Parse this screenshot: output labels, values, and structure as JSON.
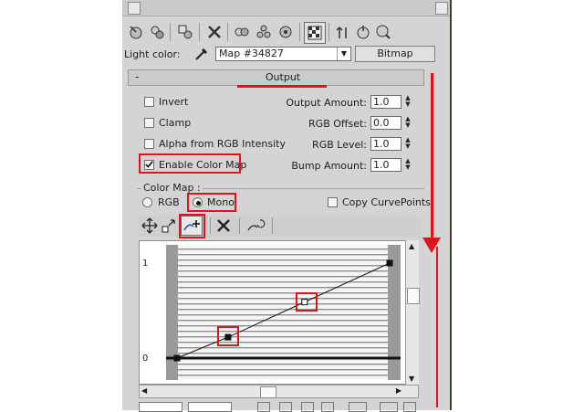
{
  "panel": {
    "light_color_label": "Light color:",
    "map_dropdown_value": "Map #34827",
    "bitmap_button_label": "Bitmap"
  },
  "toolbar_icons": [
    "pick-material-icon",
    "get-material-icon",
    "put-material-icon",
    "delete-icon",
    "copy-material-icon",
    "unique-icon",
    "show-map-icon",
    "checker-icon",
    "go-to-parent-icon",
    "go-forward-icon",
    "material-navigator-icon"
  ],
  "output": {
    "rollout_minus": "-",
    "rollout_title": "Output",
    "invert_label": "Invert",
    "clamp_label": "Clamp",
    "alpha_label": "Alpha from RGB Intensity",
    "enable_color_map_label": "Enable Color Map",
    "enable_color_map_checked": true,
    "output_amount_label": "Output Amount:",
    "output_amount_value": "1.0",
    "rgb_offset_label": "RGB Offset:",
    "rgb_offset_value": "0.0",
    "rgb_level_label": "RGB Level:",
    "rgb_level_value": "1.0",
    "bump_amount_label": "Bump Amount:",
    "bump_amount_value": "1.0"
  },
  "color_map": {
    "group_label": "Color Map :",
    "rgb_label": "RGB",
    "mono_label": "Mono",
    "mono_selected": true,
    "copy_curve_points_label": "Copy CurvePoints",
    "tool_icons": [
      "move-icon",
      "scale-point-icon",
      "add-point-icon",
      "delete-point-icon",
      "reset-curve-icon"
    ],
    "graph": {
      "y_top_label": "1",
      "y_bottom_label": "0",
      "curve_points": [
        [
          0,
          0
        ],
        [
          0.24,
          0.22
        ],
        [
          0.6,
          0.59
        ],
        [
          1,
          1
        ]
      ]
    }
  },
  "colors": {
    "annotation": "#e0121b",
    "panel_bg": "#d4d4d4"
  }
}
